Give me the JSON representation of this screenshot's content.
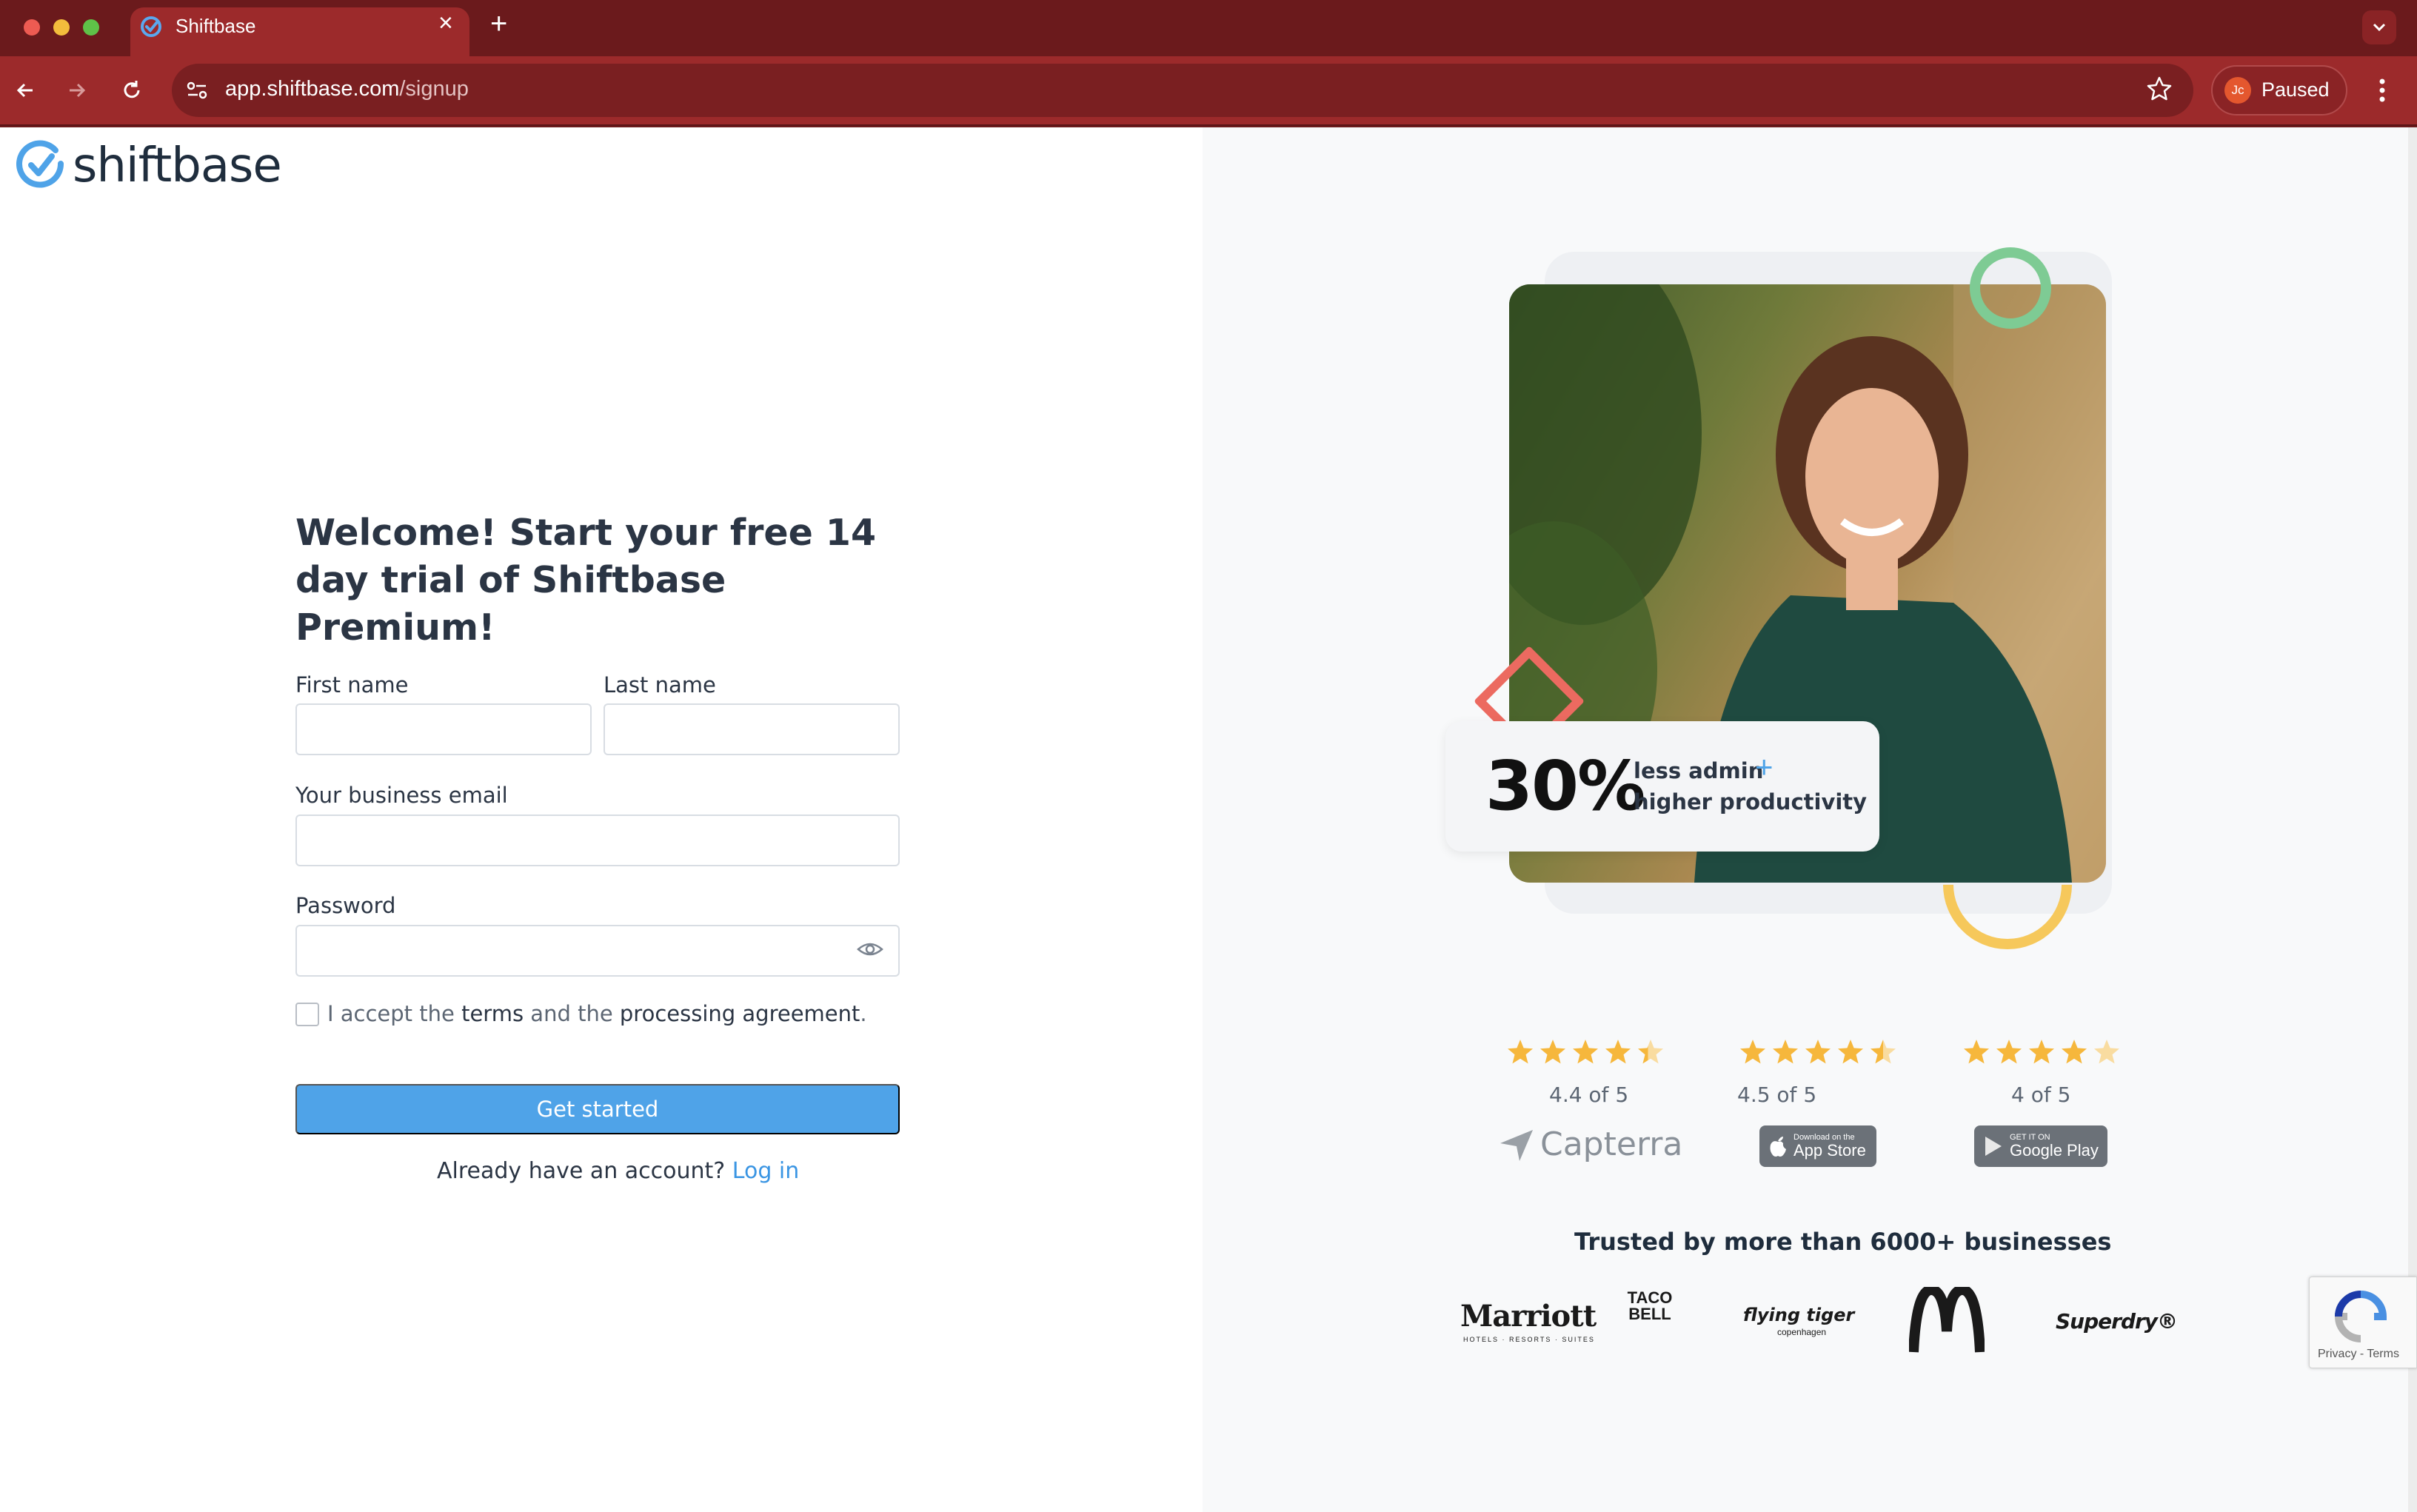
{
  "browser": {
    "tab_title": "Shiftbase",
    "url_host": "app.shiftbase.com",
    "url_path": "/signup",
    "profile_initials": "Jc",
    "profile_status": "Paused"
  },
  "brand": {
    "name": "shiftbase",
    "accent_color": "#4fa3e8"
  },
  "signup": {
    "headline": "Welcome! Start your free 14 day trial of Shiftbase Premium!",
    "first_name_label": "First name",
    "first_name_value": "",
    "last_name_label": "Last name",
    "last_name_value": "",
    "email_label": "Your business email",
    "email_value": "",
    "password_label": "Password",
    "password_value": "",
    "terms_prefix": "I accept the",
    "terms_link": "terms",
    "terms_middle": "and the",
    "agreement_link": "processing agreement",
    "terms_suffix": ".",
    "terms_checked": false,
    "submit_label": "Get started",
    "login_prompt": "Already have an account?",
    "login_link": "Log in"
  },
  "hero": {
    "stat_value": "30%",
    "stat_line1": "less admin",
    "stat_plus": "+",
    "stat_line2": "higher productivity"
  },
  "ratings": [
    {
      "stars": 4.4,
      "text": "4.4 of 5",
      "source": "Capterra"
    },
    {
      "stars": 4.5,
      "text": "4.5 of 5",
      "source_small": "Download on the",
      "source": "App Store"
    },
    {
      "stars": 4.0,
      "text": "4 of 5",
      "source_small": "GET IT ON",
      "source": "Google Play"
    }
  ],
  "trusted": {
    "heading": "Trusted by more than 6000+ businesses",
    "logos": [
      {
        "name": "Marriott",
        "sub": "HOTELS · RESORTS · SUITES"
      },
      {
        "name": "TACO BELL"
      },
      {
        "name": "flying tiger",
        "sub": "copenhagen"
      },
      {
        "name": "McDonald's"
      },
      {
        "name": "Superdry®"
      }
    ]
  },
  "recaptcha": {
    "links": "Privacy - Terms"
  }
}
